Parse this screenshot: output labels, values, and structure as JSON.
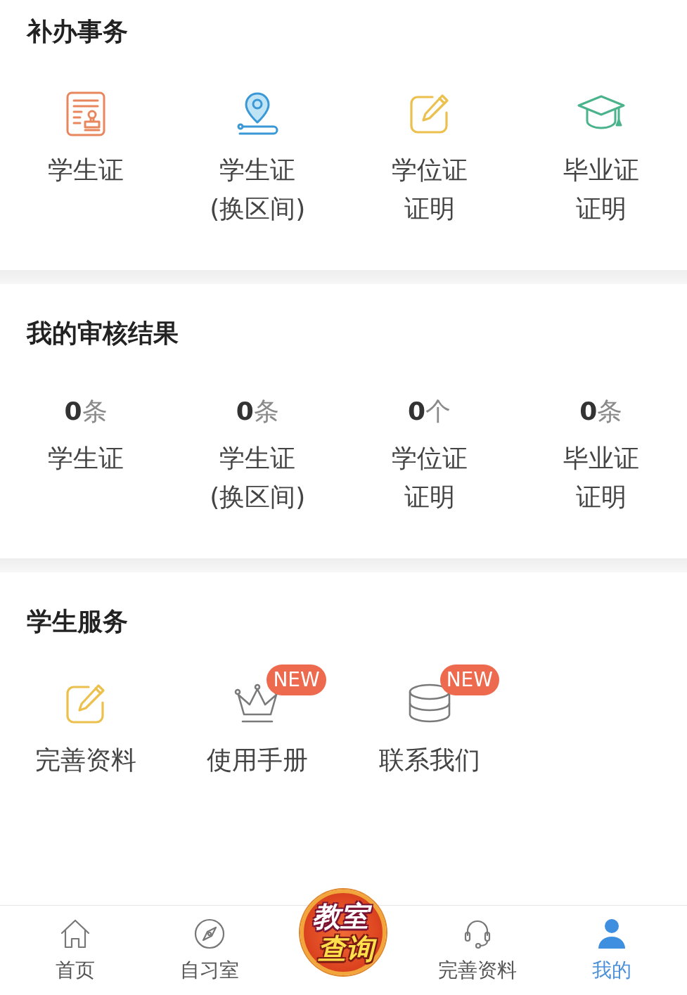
{
  "sections": [
    {
      "kind": "icon_grid",
      "title": "补办事务",
      "items": [
        {
          "label": "学生证"
        },
        {
          "label": "学生证(换区间)"
        },
        {
          "label": "学位证证明"
        },
        {
          "label": "毕业证证明"
        }
      ]
    },
    {
      "kind": "count_grid",
      "title": "我的审核结果",
      "items": [
        {
          "count": "**0**条",
          "label": "学生证"
        },
        {
          "count": "**0**条",
          "label": "学生证(换区间)"
        },
        {
          "count": "**0**个",
          "label": "学位证证明"
        },
        {
          "count": "**0**条",
          "label": "毕业证证明"
        }
      ]
    },
    {
      "kind": "icon_grid",
      "title": "学生服务",
      "items": [
        {
          "label": "完善资料"
        },
        {
          "label": "使用手册",
          "badge": "NEW"
        },
        {
          "label": "联系我们",
          "badge": "NEW"
        }
      ]
    }
  ],
  "tab_bar": {
    "tabs": [
      {
        "label": "首页",
        "selected": false
      },
      {
        "label": "自习室",
        "selected": false
      },
      {
        "label": "完善资料",
        "selected": false
      },
      {
        "label": "我的",
        "selected": true
      }
    ],
    "center_button": {
      "lines": [
        "教室",
        "查询"
      ]
    }
  }
}
